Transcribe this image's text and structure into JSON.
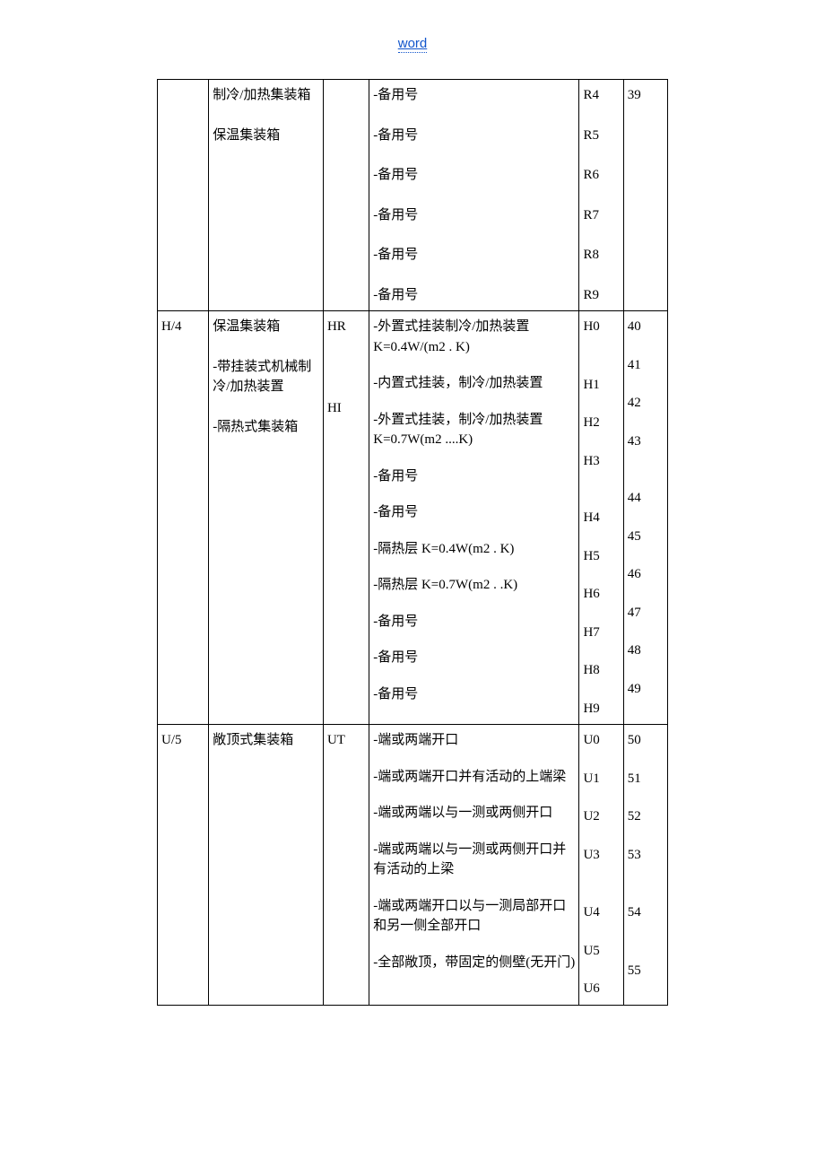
{
  "header": {
    "title": "word"
  },
  "row1": {
    "col2": [
      "制冷/加热集装箱",
      "保温集装箱"
    ],
    "col4": [
      "-备用号",
      "-备用号",
      "-备用号",
      "-备用号",
      "-备用号",
      "-备用号"
    ],
    "col5": [
      "R4",
      "R5",
      "R6",
      "R7",
      "R8",
      "R9"
    ],
    "col6": [
      "39"
    ]
  },
  "row2": {
    "col1": "H/4",
    "col2": [
      "保温集装箱",
      "-带挂装式机械制冷/加热装置",
      "-隔热式集装箱"
    ],
    "col3": [
      "HR",
      "HI"
    ],
    "col4": [
      "-外置式挂装制冷/加热装置K=0.4W/(m2 . K)",
      "-内置式挂装，制冷/加热装置",
      "-外置式挂装，制冷/加热装置K=0.7W(m2 ....K)",
      "-备用号",
      "-备用号",
      "-隔热层 K=0.4W(m2 . K)",
      "-隔热层 K=0.7W(m2 . .K)",
      "-备用号",
      "-备用号",
      "-备用号"
    ],
    "col5": [
      "H0",
      "H1",
      "H2",
      "H3",
      "H4",
      "H5",
      "H6",
      "H7",
      "H8",
      "H9"
    ],
    "col6": [
      "40",
      "41",
      "42",
      "43",
      "44",
      "45",
      "46",
      "47",
      "48",
      "49"
    ]
  },
  "row3": {
    "col1": "U/5",
    "col2": [
      "敞顶式集装箱"
    ],
    "col3": [
      "UT"
    ],
    "col4": [
      "-端或两端开口",
      "-端或两端开口并有活动的上端梁",
      "-端或两端以与一测或两侧开口",
      "-端或两端以与一测或两侧开口并有活动的上梁",
      "-端或两端开口以与一测局部开口和另一侧全部开口",
      "-全部敞顶，带固定的侧壁(无开门)"
    ],
    "col5": [
      "U0",
      "U1",
      "U2",
      "U3",
      "U4",
      "U5",
      "U6"
    ],
    "col6": [
      "50",
      "51",
      "52",
      "53",
      "54",
      "55"
    ]
  }
}
